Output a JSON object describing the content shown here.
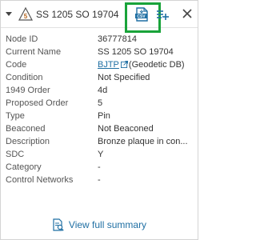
{
  "header": {
    "title": "SS 1205 SO 19704",
    "mark_icon": "survey-mark-triangle-icon",
    "csv_icon": "export-csv-icon",
    "add_icon": "add-to-list-icon",
    "close_icon": "close-icon",
    "accent_color": "#19a33a",
    "link_color": "#1f6fa3"
  },
  "rows": [
    {
      "label": "Node ID",
      "value": "36777814"
    },
    {
      "label": "Current Name",
      "value": "SS 1205 SO 19704"
    },
    {
      "label": "Code",
      "link": "BJTP",
      "suffix": "(Geodetic DB)"
    },
    {
      "label": "Condition",
      "value": "Not Specified"
    },
    {
      "label": "1949 Order",
      "value": "4d"
    },
    {
      "label": "Proposed Order",
      "value": "5"
    },
    {
      "label": "Type",
      "value": "Pin"
    },
    {
      "label": "Beaconed",
      "value": "Not Beaconed"
    },
    {
      "label": "Description",
      "value": "Bronze plaque in con..."
    },
    {
      "label": "SDC",
      "value": "Y"
    },
    {
      "label": "Category",
      "value": "-"
    },
    {
      "label": "Control Networks",
      "value": "-"
    }
  ],
  "footer": {
    "link_label": "View full summary",
    "icon": "summary-document-icon"
  }
}
